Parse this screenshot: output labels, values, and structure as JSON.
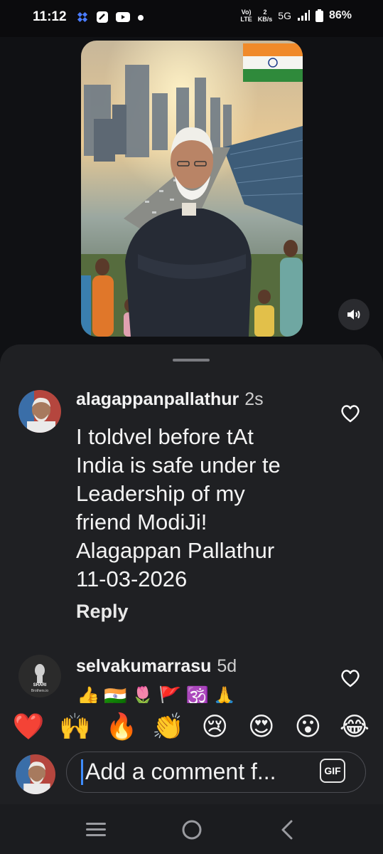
{
  "status_bar": {
    "time": "11:12",
    "net_top": "Vo)",
    "net_bottom": "LTE",
    "speed_top": "2",
    "speed_bottom": "KB/s",
    "network": "5G",
    "battery": "86%"
  },
  "comments": [
    {
      "username": "alagappanpallathur",
      "time": "2s",
      "text": "I toldvel before tAt\nIndia is safe under te\nLeadership of my\nfriend ModiJi!\nAlagappan Pallathur\n11-03-2026",
      "reply_label": "Reply"
    },
    {
      "username": "selvakumarrasu",
      "time": "5d",
      "text_preview": "👍🇮🇳🌷🚩🕉️🙏"
    }
  ],
  "avatar_texts": {
    "selva_top": "SHARI",
    "selva_bottom": "Brothers.io"
  },
  "reactions": [
    "❤️",
    "🙌",
    "🔥",
    "👏",
    "😢",
    "😍",
    "😮",
    "😂"
  ],
  "composer": {
    "input_value": "Add a comment f...",
    "gif_label": "GIF"
  },
  "colors": {
    "sheet_bg": "#1f2023",
    "caret": "#3e8cff"
  }
}
